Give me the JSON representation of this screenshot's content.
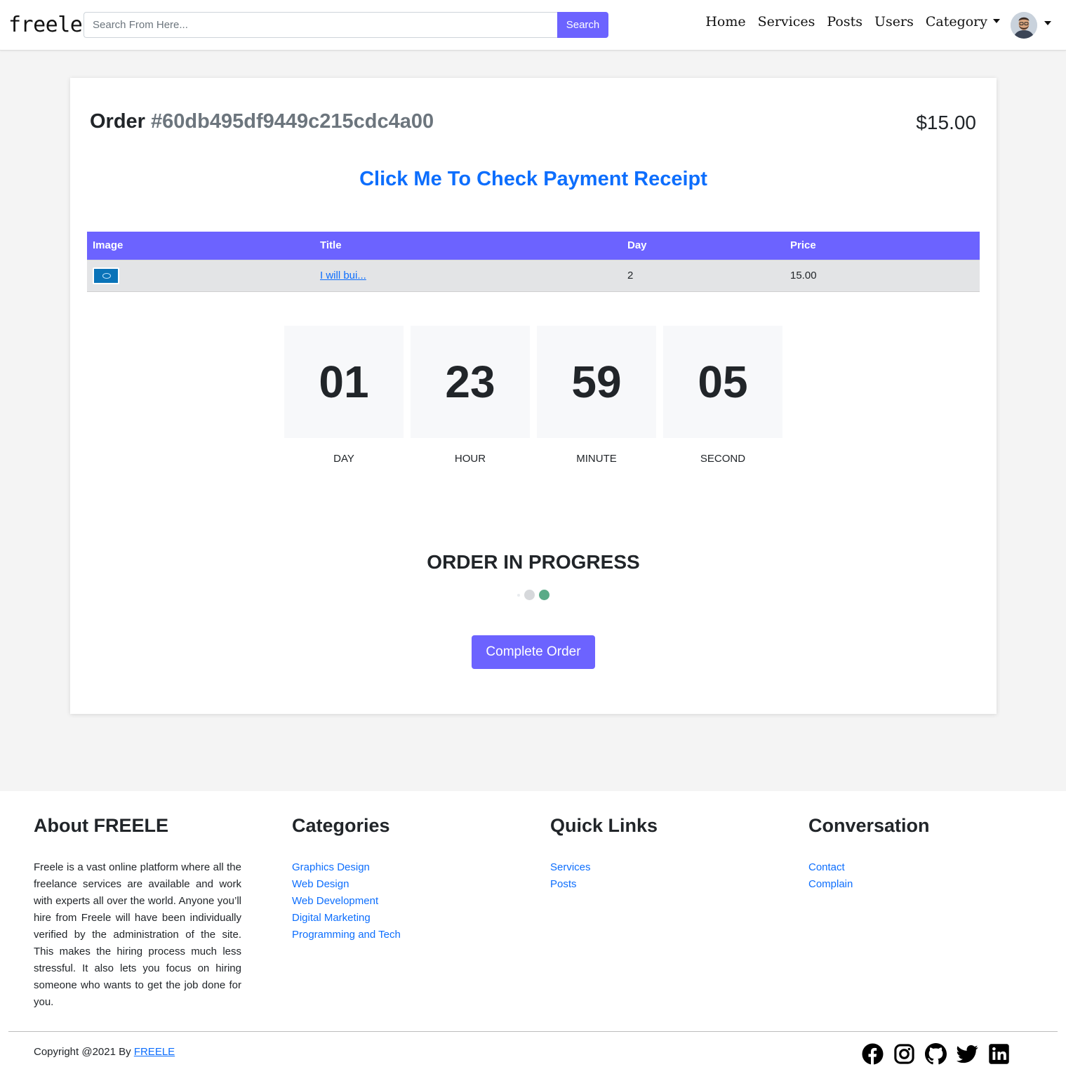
{
  "nav": {
    "brand": "freele",
    "search_placeholder": "Search From Here...",
    "search_button": "Search",
    "links": [
      "Home",
      "Services",
      "Posts",
      "Users"
    ],
    "category_label": "Category"
  },
  "order": {
    "label": "Order",
    "id": "#60db495df9449c215cdc4a00",
    "price": "$15.00",
    "receipt_link": "Click Me To Check Payment Receipt"
  },
  "table": {
    "headers": [
      "Image",
      "Title",
      "Day",
      "Price"
    ],
    "rows": [
      {
        "title": "I will bui...",
        "day": "2",
        "price": "15.00"
      }
    ]
  },
  "countdown": [
    {
      "value": "01",
      "label": "DAY"
    },
    {
      "value": "23",
      "label": "HOUR"
    },
    {
      "value": "59",
      "label": "MINUTE"
    },
    {
      "value": "05",
      "label": "SECOND"
    }
  ],
  "status": {
    "title": "ORDER IN PROGRESS",
    "complete_button": "Complete Order",
    "dot_colors": [
      "#e9ecef",
      "#d6d8db",
      "#5aab88"
    ]
  },
  "footer": {
    "about_title": "About FREELE",
    "about_text": "Freele is a vast online platform where all the freelance services are available and work with experts all over the world. Anyone you’ll hire from Freele will have been individually verified by the administration of the site. This makes the hiring process much less stressful. It also lets you focus on hiring someone who wants to get the job done for you.",
    "categories_title": "Categories",
    "categories": [
      "Graphics Design",
      "Web Design",
      "Web Development",
      "Digital Marketing",
      "Programming and Tech"
    ],
    "quick_title": "Quick Links",
    "quick_links": [
      "Services",
      "Posts"
    ],
    "conv_title": "Conversation",
    "conv_links": [
      "Contact",
      "Complain"
    ],
    "copyright_prefix": "Copyright @2021 By",
    "copyright_link": "FREELE",
    "social_icons": [
      "facebook-icon",
      "instagram-icon",
      "github-icon",
      "twitter-icon",
      "linkedin-icon"
    ]
  },
  "colors": {
    "accent": "#6c63ff",
    "link": "#0d6efd",
    "page_bg": "#f4f4f4"
  }
}
